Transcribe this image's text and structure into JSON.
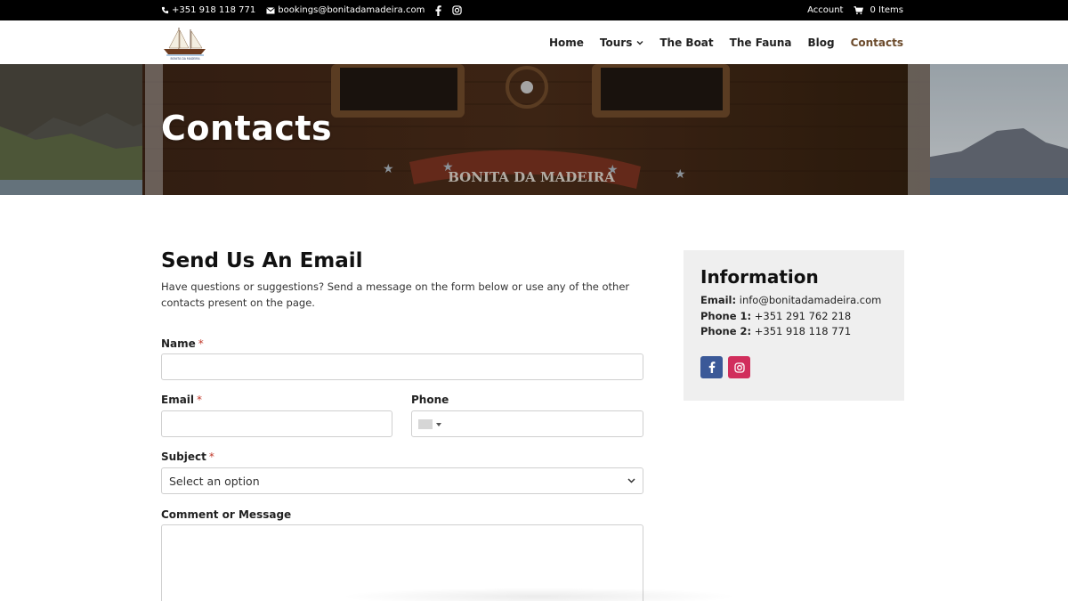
{
  "topbar": {
    "phone": "+351 918 118 771",
    "email": "bookings@bonitadamadeira.com",
    "account": "Account",
    "cart": "0 Items"
  },
  "nav": {
    "items": [
      {
        "label": "Home"
      },
      {
        "label": "Tours"
      },
      {
        "label": "The Boat"
      },
      {
        "label": "The Fauna"
      },
      {
        "label": "Blog"
      },
      {
        "label": "Contacts"
      }
    ],
    "active": "Contacts"
  },
  "hero": {
    "title": "Contacts",
    "boat_name": "BONITA DA MADEIRA"
  },
  "form": {
    "title": "Send Us An Email",
    "intro": "Have questions or suggestions? Send a message on the form below or use any of the other contacts present on the page.",
    "name_label": "Name",
    "email_label": "Email",
    "phone_label": "Phone",
    "subject_label": "Subject",
    "subject_value": "Select an option",
    "message_label": "Comment or Message",
    "required_mark": "*"
  },
  "info": {
    "title": "Information",
    "email_label": "Email:",
    "email_value": "info@bonitadamadeira.com",
    "phone1_label": "Phone 1:",
    "phone1_value": "+351 291 762 218",
    "phone2_label": "Phone 2:",
    "phone2_value": "+351 918 118 771"
  },
  "colors": {
    "accent": "#6b4a2b",
    "facebook": "#3b5998",
    "instagram": "#d12e5c",
    "required": "#c0392b"
  },
  "icons": [
    "phone-icon",
    "mail-icon",
    "facebook-icon",
    "instagram-icon",
    "cart-icon",
    "chevron-down-icon"
  ]
}
